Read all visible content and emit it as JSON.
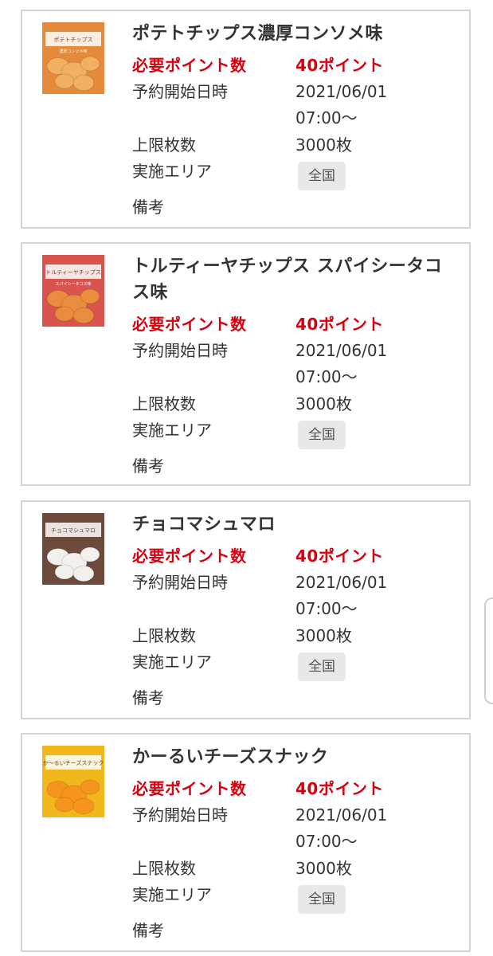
{
  "labels": {
    "points": "必要ポイント数",
    "reservation_start": "予約開始日時",
    "limit": "上限枚数",
    "area": "実施エリア",
    "remarks": "備考"
  },
  "products": [
    {
      "name": "ポテトチップス濃厚コンソメ味",
      "points": "40ポイント",
      "reservation_date": "2021/06/01",
      "reservation_time": "07:00〜",
      "limit": "3000枚",
      "area": "全国",
      "image": {
        "label": "ポテトチップス",
        "sub": "濃厚コンソメ味",
        "bg": "#e48a3a",
        "food": "#f0b060",
        "icon": "potato-chips-package-image"
      }
    },
    {
      "name": "トルティーヤチップス スパイシータコス味",
      "points": "40ポイント",
      "reservation_date": "2021/06/01",
      "reservation_time": "07:00〜",
      "limit": "3000枚",
      "area": "全国",
      "image": {
        "label": "トルティーヤチップス",
        "sub": "スパイシータコス味",
        "bg": "#d9534f",
        "food": "#e98c3e",
        "icon": "tortilla-chips-package-image"
      }
    },
    {
      "name": "チョコマシュマロ",
      "points": "40ポイント",
      "reservation_date": "2021/06/01",
      "reservation_time": "07:00〜",
      "limit": "3000枚",
      "area": "全国",
      "image": {
        "label": "チョコマシュマロ",
        "sub": "",
        "bg": "#6e4a3c",
        "food": "#f2f0ec",
        "icon": "chocolate-marshmallow-package-image"
      }
    },
    {
      "name": "かーるいチーズスナック",
      "points": "40ポイント",
      "reservation_date": "2021/06/01",
      "reservation_time": "07:00〜",
      "limit": "3000枚",
      "area": "全国",
      "image": {
        "label": "か〜るいチーズスナック",
        "sub": "",
        "bg": "#f2b71c",
        "food": "#f6951d",
        "icon": "cheese-snack-package-image"
      }
    }
  ],
  "colors": {
    "accent_red": "#d7000f",
    "border": "#d4d4d4",
    "badge_bg": "#e8e8e8"
  }
}
